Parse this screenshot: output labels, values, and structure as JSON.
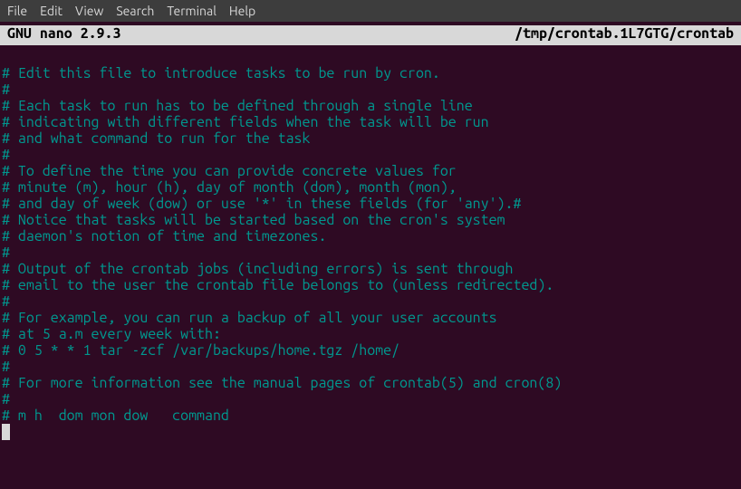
{
  "menu": {
    "file": "File",
    "edit": "Edit",
    "view": "View",
    "search": "Search",
    "terminal": "Terminal",
    "help": "Help"
  },
  "titlebar": {
    "app": "  GNU nano 2.9.3",
    "filepath": "/tmp/crontab.1L7GTG/crontab  "
  },
  "editor": {
    "lines": [
      "",
      "# Edit this file to introduce tasks to be run by cron.",
      "#",
      "# Each task to run has to be defined through a single line",
      "# indicating with different fields when the task will be run",
      "# and what command to run for the task",
      "#",
      "# To define the time you can provide concrete values for",
      "# minute (m), hour (h), day of month (dom), month (mon),",
      "# and day of week (dow) or use '*' in these fields (for 'any').#",
      "# Notice that tasks will be started based on the cron's system",
      "# daemon's notion of time and timezones.",
      "#",
      "# Output of the crontab jobs (including errors) is sent through",
      "# email to the user the crontab file belongs to (unless redirected).",
      "#",
      "# For example, you can run a backup of all your user accounts",
      "# at 5 a.m every week with:",
      "# 0 5 * * 1 tar -zcf /var/backups/home.tgz /home/",
      "#",
      "# For more information see the manual pages of crontab(5) and cron(8)",
      "#",
      "# m h  dom mon dow   command"
    ]
  }
}
